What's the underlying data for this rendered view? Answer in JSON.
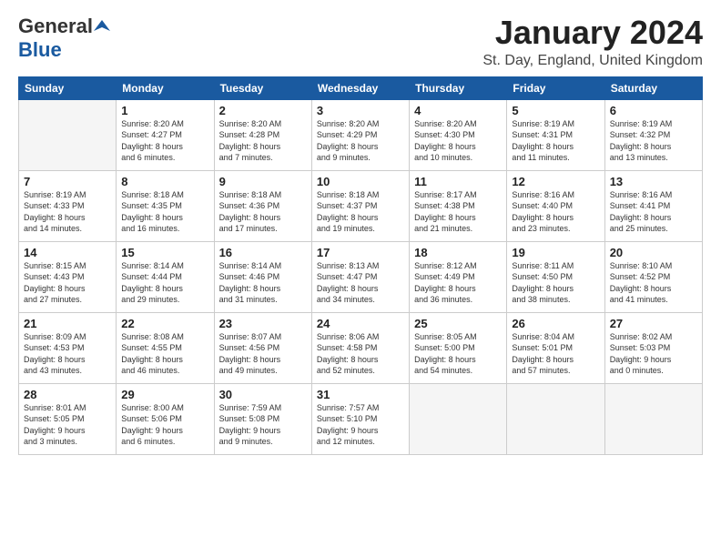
{
  "logo": {
    "general": "General",
    "blue": "Blue"
  },
  "title": "January 2024",
  "location": "St. Day, England, United Kingdom",
  "days_of_week": [
    "Sunday",
    "Monday",
    "Tuesday",
    "Wednesday",
    "Thursday",
    "Friday",
    "Saturday"
  ],
  "weeks": [
    [
      {
        "day": "",
        "info": ""
      },
      {
        "day": "1",
        "info": "Sunrise: 8:20 AM\nSunset: 4:27 PM\nDaylight: 8 hours\nand 6 minutes."
      },
      {
        "day": "2",
        "info": "Sunrise: 8:20 AM\nSunset: 4:28 PM\nDaylight: 8 hours\nand 7 minutes."
      },
      {
        "day": "3",
        "info": "Sunrise: 8:20 AM\nSunset: 4:29 PM\nDaylight: 8 hours\nand 9 minutes."
      },
      {
        "day": "4",
        "info": "Sunrise: 8:20 AM\nSunset: 4:30 PM\nDaylight: 8 hours\nand 10 minutes."
      },
      {
        "day": "5",
        "info": "Sunrise: 8:19 AM\nSunset: 4:31 PM\nDaylight: 8 hours\nand 11 minutes."
      },
      {
        "day": "6",
        "info": "Sunrise: 8:19 AM\nSunset: 4:32 PM\nDaylight: 8 hours\nand 13 minutes."
      }
    ],
    [
      {
        "day": "7",
        "info": "Sunrise: 8:19 AM\nSunset: 4:33 PM\nDaylight: 8 hours\nand 14 minutes."
      },
      {
        "day": "8",
        "info": "Sunrise: 8:18 AM\nSunset: 4:35 PM\nDaylight: 8 hours\nand 16 minutes."
      },
      {
        "day": "9",
        "info": "Sunrise: 8:18 AM\nSunset: 4:36 PM\nDaylight: 8 hours\nand 17 minutes."
      },
      {
        "day": "10",
        "info": "Sunrise: 8:18 AM\nSunset: 4:37 PM\nDaylight: 8 hours\nand 19 minutes."
      },
      {
        "day": "11",
        "info": "Sunrise: 8:17 AM\nSunset: 4:38 PM\nDaylight: 8 hours\nand 21 minutes."
      },
      {
        "day": "12",
        "info": "Sunrise: 8:16 AM\nSunset: 4:40 PM\nDaylight: 8 hours\nand 23 minutes."
      },
      {
        "day": "13",
        "info": "Sunrise: 8:16 AM\nSunset: 4:41 PM\nDaylight: 8 hours\nand 25 minutes."
      }
    ],
    [
      {
        "day": "14",
        "info": "Sunrise: 8:15 AM\nSunset: 4:43 PM\nDaylight: 8 hours\nand 27 minutes."
      },
      {
        "day": "15",
        "info": "Sunrise: 8:14 AM\nSunset: 4:44 PM\nDaylight: 8 hours\nand 29 minutes."
      },
      {
        "day": "16",
        "info": "Sunrise: 8:14 AM\nSunset: 4:46 PM\nDaylight: 8 hours\nand 31 minutes."
      },
      {
        "day": "17",
        "info": "Sunrise: 8:13 AM\nSunset: 4:47 PM\nDaylight: 8 hours\nand 34 minutes."
      },
      {
        "day": "18",
        "info": "Sunrise: 8:12 AM\nSunset: 4:49 PM\nDaylight: 8 hours\nand 36 minutes."
      },
      {
        "day": "19",
        "info": "Sunrise: 8:11 AM\nSunset: 4:50 PM\nDaylight: 8 hours\nand 38 minutes."
      },
      {
        "day": "20",
        "info": "Sunrise: 8:10 AM\nSunset: 4:52 PM\nDaylight: 8 hours\nand 41 minutes."
      }
    ],
    [
      {
        "day": "21",
        "info": "Sunrise: 8:09 AM\nSunset: 4:53 PM\nDaylight: 8 hours\nand 43 minutes."
      },
      {
        "day": "22",
        "info": "Sunrise: 8:08 AM\nSunset: 4:55 PM\nDaylight: 8 hours\nand 46 minutes."
      },
      {
        "day": "23",
        "info": "Sunrise: 8:07 AM\nSunset: 4:56 PM\nDaylight: 8 hours\nand 49 minutes."
      },
      {
        "day": "24",
        "info": "Sunrise: 8:06 AM\nSunset: 4:58 PM\nDaylight: 8 hours\nand 52 minutes."
      },
      {
        "day": "25",
        "info": "Sunrise: 8:05 AM\nSunset: 5:00 PM\nDaylight: 8 hours\nand 54 minutes."
      },
      {
        "day": "26",
        "info": "Sunrise: 8:04 AM\nSunset: 5:01 PM\nDaylight: 8 hours\nand 57 minutes."
      },
      {
        "day": "27",
        "info": "Sunrise: 8:02 AM\nSunset: 5:03 PM\nDaylight: 9 hours\nand 0 minutes."
      }
    ],
    [
      {
        "day": "28",
        "info": "Sunrise: 8:01 AM\nSunset: 5:05 PM\nDaylight: 9 hours\nand 3 minutes."
      },
      {
        "day": "29",
        "info": "Sunrise: 8:00 AM\nSunset: 5:06 PM\nDaylight: 9 hours\nand 6 minutes."
      },
      {
        "day": "30",
        "info": "Sunrise: 7:59 AM\nSunset: 5:08 PM\nDaylight: 9 hours\nand 9 minutes."
      },
      {
        "day": "31",
        "info": "Sunrise: 7:57 AM\nSunset: 5:10 PM\nDaylight: 9 hours\nand 12 minutes."
      },
      {
        "day": "",
        "info": ""
      },
      {
        "day": "",
        "info": ""
      },
      {
        "day": "",
        "info": ""
      }
    ]
  ]
}
